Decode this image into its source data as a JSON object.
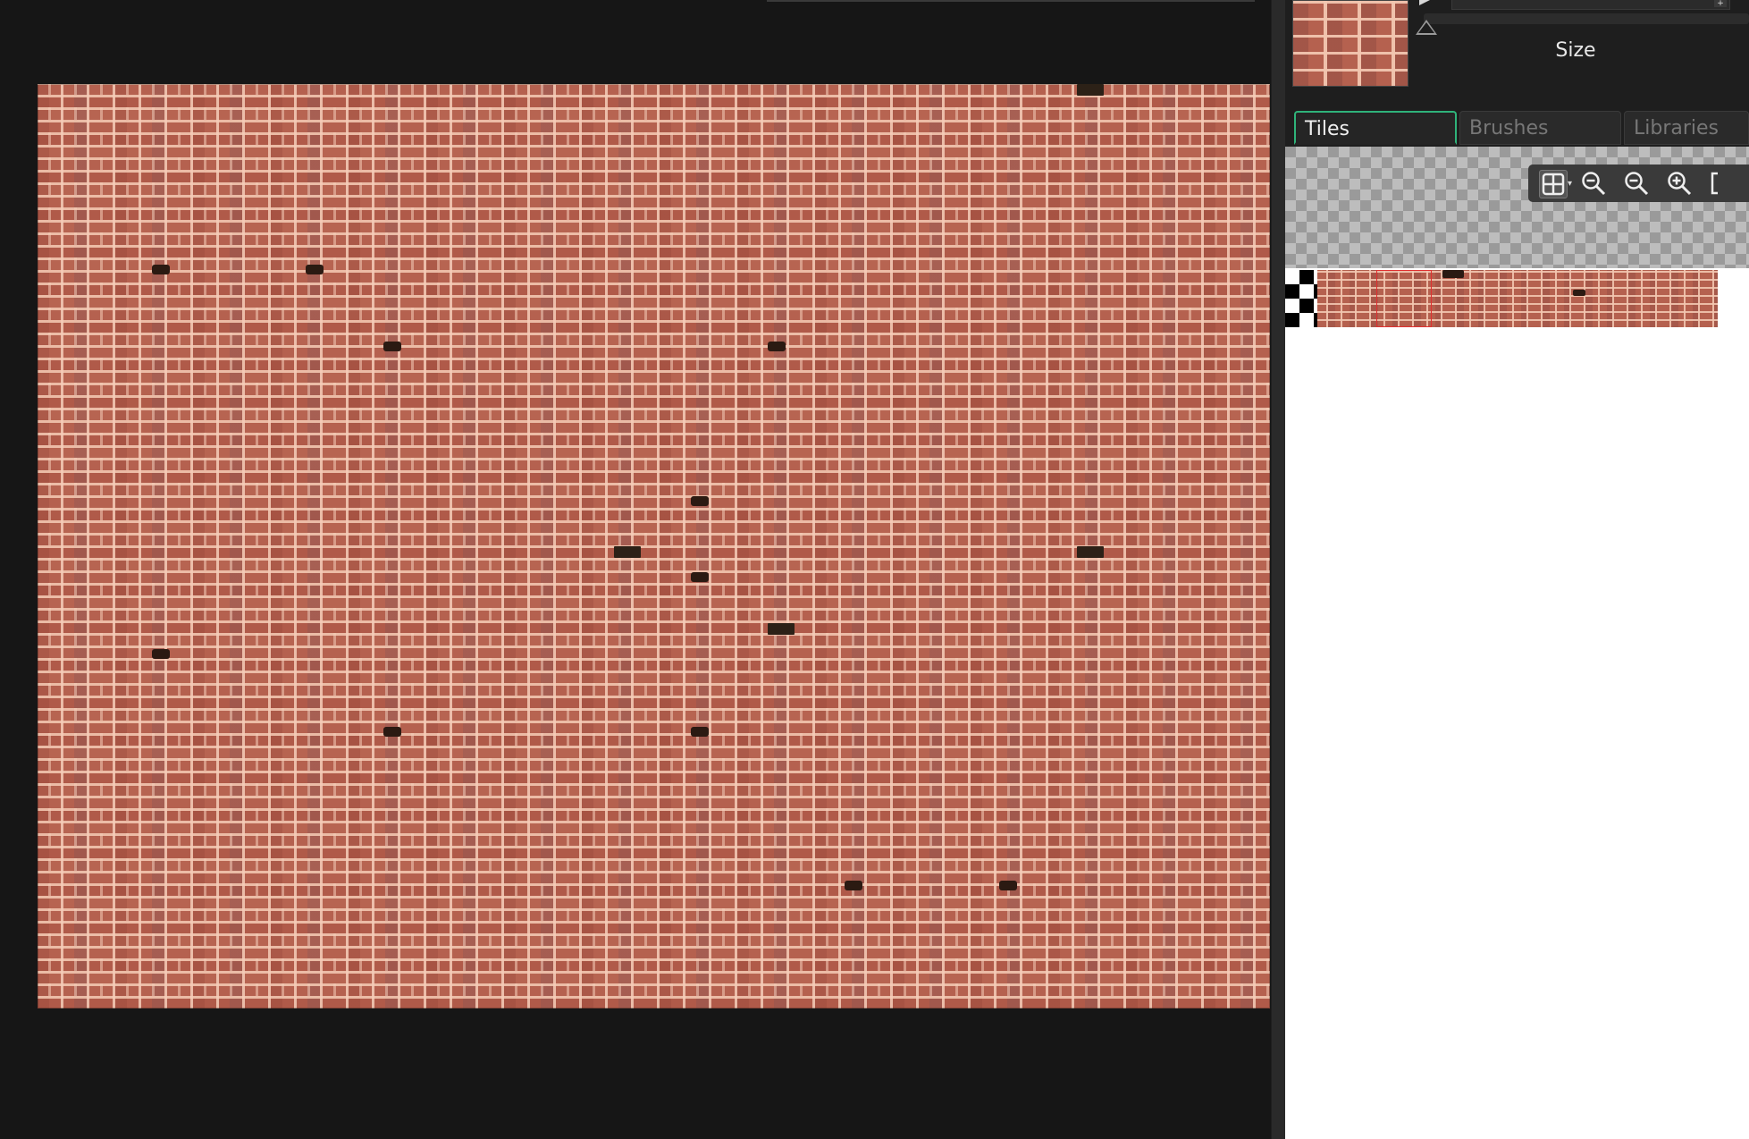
{
  "viewport": {
    "canvas_texture": "brick-wall"
  },
  "dock": {
    "size_label": "Size",
    "tabs": [
      {
        "label": "Tiles",
        "active": true
      },
      {
        "label": "Brushes",
        "active": false
      },
      {
        "label": "Libraries",
        "active": false
      }
    ],
    "toolbar_icons": [
      "grid-icon",
      "zoom-out-icon",
      "zoom-out-icon",
      "zoom-in-icon",
      "fit-icon"
    ]
  },
  "colors": {
    "active_tab_accent": "#2fb37a",
    "selection": "#e03030",
    "background": "#161616"
  }
}
